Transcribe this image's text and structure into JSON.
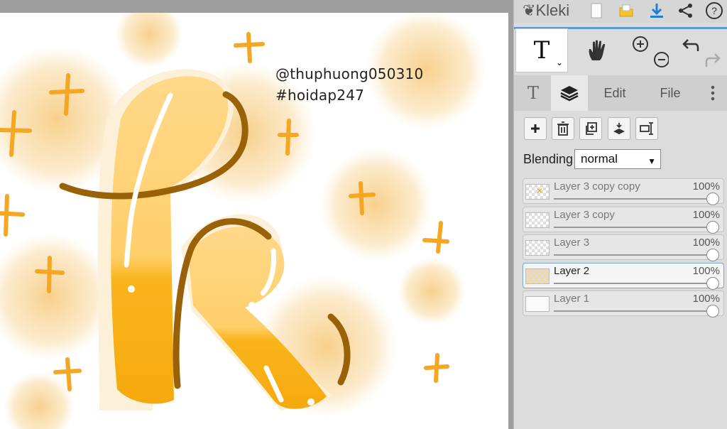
{
  "app": {
    "name": "Kleki"
  },
  "artwork": {
    "credit": "@thuphuong050310",
    "tag": "#hoidap247"
  },
  "toolbar": {
    "tools": [
      "text-tool",
      "hand-tool",
      "zoom",
      "undo-redo"
    ]
  },
  "tabs": {
    "text_icon": "T",
    "edit": "Edit",
    "file": "File"
  },
  "blending": {
    "label": "Blending",
    "value": "normal"
  },
  "layers": [
    {
      "name": "Layer 3 copy copy",
      "opacity": "100%"
    },
    {
      "name": "Layer 3 copy",
      "opacity": "100%"
    },
    {
      "name": "Layer 3",
      "opacity": "100%"
    },
    {
      "name": "Layer 2",
      "opacity": "100%",
      "active": true
    },
    {
      "name": "Layer 1",
      "opacity": "100%"
    }
  ],
  "colors": {
    "accent": "#1e7fd6",
    "gold": "#f5b21a",
    "brown": "#9a6208",
    "glow": "#f8d79a"
  }
}
